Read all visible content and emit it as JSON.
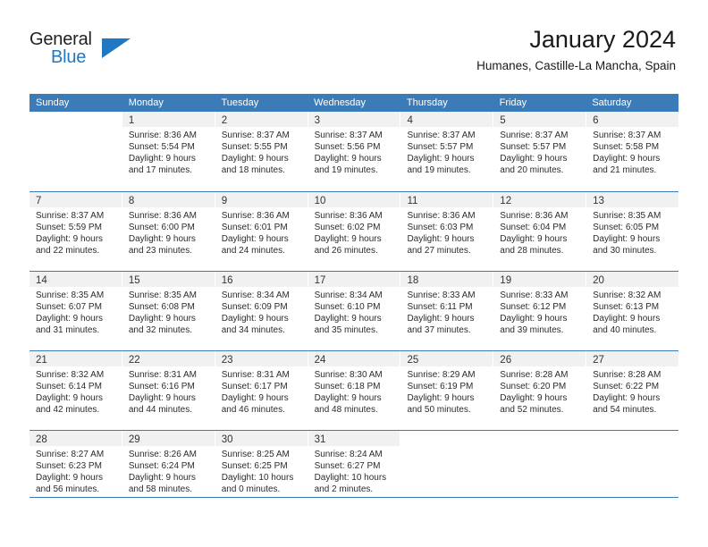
{
  "logo": {
    "line1": "General",
    "line2": "Blue",
    "triangle_icon": "triangle-icon",
    "color_dark": "#231f20",
    "color_blue": "#1f78c1"
  },
  "header": {
    "title": "January 2024",
    "subtitle": "Humanes, Castille-La Mancha, Spain"
  },
  "theme": {
    "header_blue": "#3b7cb8",
    "day_band_gray": "#f1f1f1",
    "text": "#2b2b2b"
  },
  "weekdays": [
    "Sunday",
    "Monday",
    "Tuesday",
    "Wednesday",
    "Thursday",
    "Friday",
    "Saturday"
  ],
  "weeks": [
    [
      {
        "day": "",
        "lines": []
      },
      {
        "day": "1",
        "lines": [
          "Sunrise: 8:36 AM",
          "Sunset: 5:54 PM",
          "Daylight: 9 hours",
          "and 17 minutes."
        ]
      },
      {
        "day": "2",
        "lines": [
          "Sunrise: 8:37 AM",
          "Sunset: 5:55 PM",
          "Daylight: 9 hours",
          "and 18 minutes."
        ]
      },
      {
        "day": "3",
        "lines": [
          "Sunrise: 8:37 AM",
          "Sunset: 5:56 PM",
          "Daylight: 9 hours",
          "and 19 minutes."
        ]
      },
      {
        "day": "4",
        "lines": [
          "Sunrise: 8:37 AM",
          "Sunset: 5:57 PM",
          "Daylight: 9 hours",
          "and 19 minutes."
        ]
      },
      {
        "day": "5",
        "lines": [
          "Sunrise: 8:37 AM",
          "Sunset: 5:57 PM",
          "Daylight: 9 hours",
          "and 20 minutes."
        ]
      },
      {
        "day": "6",
        "lines": [
          "Sunrise: 8:37 AM",
          "Sunset: 5:58 PM",
          "Daylight: 9 hours",
          "and 21 minutes."
        ]
      }
    ],
    [
      {
        "day": "7",
        "lines": [
          "Sunrise: 8:37 AM",
          "Sunset: 5:59 PM",
          "Daylight: 9 hours",
          "and 22 minutes."
        ]
      },
      {
        "day": "8",
        "lines": [
          "Sunrise: 8:36 AM",
          "Sunset: 6:00 PM",
          "Daylight: 9 hours",
          "and 23 minutes."
        ]
      },
      {
        "day": "9",
        "lines": [
          "Sunrise: 8:36 AM",
          "Sunset: 6:01 PM",
          "Daylight: 9 hours",
          "and 24 minutes."
        ]
      },
      {
        "day": "10",
        "lines": [
          "Sunrise: 8:36 AM",
          "Sunset: 6:02 PM",
          "Daylight: 9 hours",
          "and 26 minutes."
        ]
      },
      {
        "day": "11",
        "lines": [
          "Sunrise: 8:36 AM",
          "Sunset: 6:03 PM",
          "Daylight: 9 hours",
          "and 27 minutes."
        ]
      },
      {
        "day": "12",
        "lines": [
          "Sunrise: 8:36 AM",
          "Sunset: 6:04 PM",
          "Daylight: 9 hours",
          "and 28 minutes."
        ]
      },
      {
        "day": "13",
        "lines": [
          "Sunrise: 8:35 AM",
          "Sunset: 6:05 PM",
          "Daylight: 9 hours",
          "and 30 minutes."
        ]
      }
    ],
    [
      {
        "day": "14",
        "lines": [
          "Sunrise: 8:35 AM",
          "Sunset: 6:07 PM",
          "Daylight: 9 hours",
          "and 31 minutes."
        ]
      },
      {
        "day": "15",
        "lines": [
          "Sunrise: 8:35 AM",
          "Sunset: 6:08 PM",
          "Daylight: 9 hours",
          "and 32 minutes."
        ]
      },
      {
        "day": "16",
        "lines": [
          "Sunrise: 8:34 AM",
          "Sunset: 6:09 PM",
          "Daylight: 9 hours",
          "and 34 minutes."
        ]
      },
      {
        "day": "17",
        "lines": [
          "Sunrise: 8:34 AM",
          "Sunset: 6:10 PM",
          "Daylight: 9 hours",
          "and 35 minutes."
        ]
      },
      {
        "day": "18",
        "lines": [
          "Sunrise: 8:33 AM",
          "Sunset: 6:11 PM",
          "Daylight: 9 hours",
          "and 37 minutes."
        ]
      },
      {
        "day": "19",
        "lines": [
          "Sunrise: 8:33 AM",
          "Sunset: 6:12 PM",
          "Daylight: 9 hours",
          "and 39 minutes."
        ]
      },
      {
        "day": "20",
        "lines": [
          "Sunrise: 8:32 AM",
          "Sunset: 6:13 PM",
          "Daylight: 9 hours",
          "and 40 minutes."
        ]
      }
    ],
    [
      {
        "day": "21",
        "lines": [
          "Sunrise: 8:32 AM",
          "Sunset: 6:14 PM",
          "Daylight: 9 hours",
          "and 42 minutes."
        ]
      },
      {
        "day": "22",
        "lines": [
          "Sunrise: 8:31 AM",
          "Sunset: 6:16 PM",
          "Daylight: 9 hours",
          "and 44 minutes."
        ]
      },
      {
        "day": "23",
        "lines": [
          "Sunrise: 8:31 AM",
          "Sunset: 6:17 PM",
          "Daylight: 9 hours",
          "and 46 minutes."
        ]
      },
      {
        "day": "24",
        "lines": [
          "Sunrise: 8:30 AM",
          "Sunset: 6:18 PM",
          "Daylight: 9 hours",
          "and 48 minutes."
        ]
      },
      {
        "day": "25",
        "lines": [
          "Sunrise: 8:29 AM",
          "Sunset: 6:19 PM",
          "Daylight: 9 hours",
          "and 50 minutes."
        ]
      },
      {
        "day": "26",
        "lines": [
          "Sunrise: 8:28 AM",
          "Sunset: 6:20 PM",
          "Daylight: 9 hours",
          "and 52 minutes."
        ]
      },
      {
        "day": "27",
        "lines": [
          "Sunrise: 8:28 AM",
          "Sunset: 6:22 PM",
          "Daylight: 9 hours",
          "and 54 minutes."
        ]
      }
    ],
    [
      {
        "day": "28",
        "lines": [
          "Sunrise: 8:27 AM",
          "Sunset: 6:23 PM",
          "Daylight: 9 hours",
          "and 56 minutes."
        ]
      },
      {
        "day": "29",
        "lines": [
          "Sunrise: 8:26 AM",
          "Sunset: 6:24 PM",
          "Daylight: 9 hours",
          "and 58 minutes."
        ]
      },
      {
        "day": "30",
        "lines": [
          "Sunrise: 8:25 AM",
          "Sunset: 6:25 PM",
          "Daylight: 10 hours",
          "and 0 minutes."
        ]
      },
      {
        "day": "31",
        "lines": [
          "Sunrise: 8:24 AM",
          "Sunset: 6:27 PM",
          "Daylight: 10 hours",
          "and 2 minutes."
        ]
      },
      {
        "day": "",
        "lines": []
      },
      {
        "day": "",
        "lines": []
      },
      {
        "day": "",
        "lines": []
      }
    ]
  ]
}
